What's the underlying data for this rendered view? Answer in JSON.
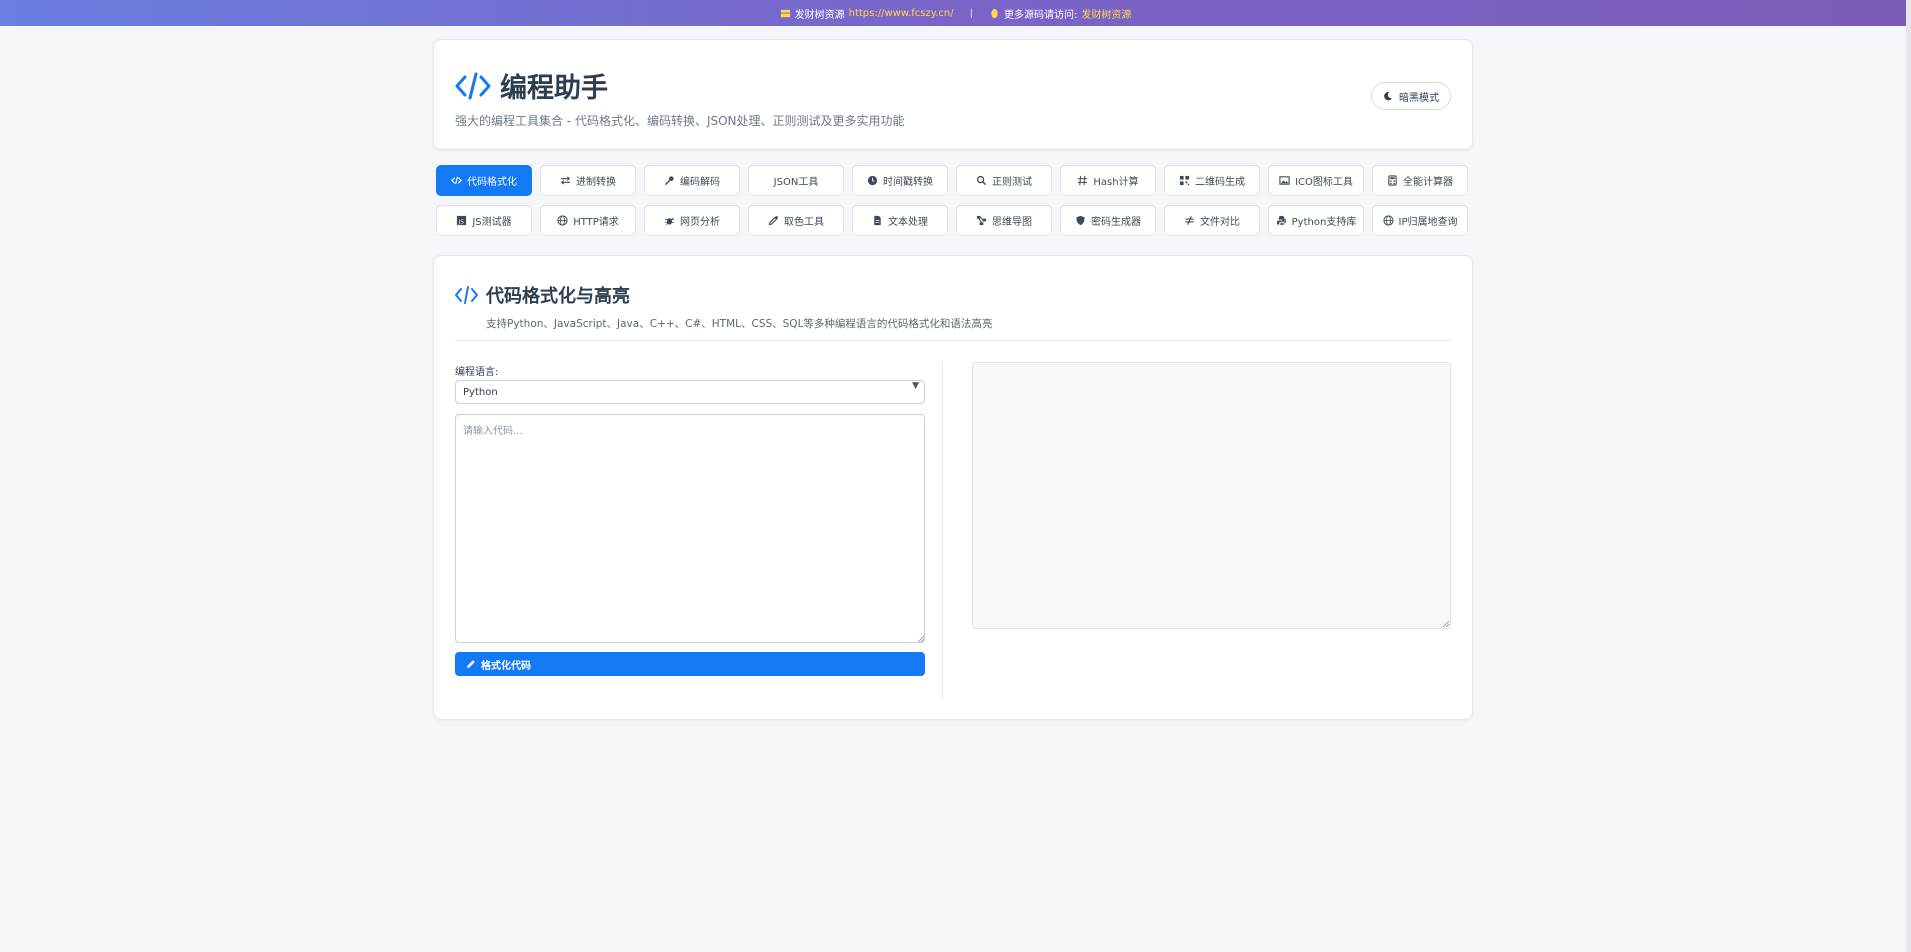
{
  "topbar": {
    "site_label": "发财树资源",
    "site_url": "https://www.fcszy.cn/",
    "separator": "|",
    "more_label": "更多源码请访问:",
    "more_link": "发财树资源"
  },
  "header": {
    "title": "编程助手",
    "subtitle": "强大的编程工具集合 - 代码格式化、编码转换、JSON处理、正则测试及更多实用功能",
    "dark_mode_label": "暗黑模式"
  },
  "tabs": {
    "row1": [
      {
        "label": "代码格式化",
        "icon": "code-icon",
        "active": true
      },
      {
        "label": "进制转换",
        "icon": "exchange-icon",
        "active": false
      },
      {
        "label": "编码解码",
        "icon": "key-icon",
        "active": false
      },
      {
        "label": "JSON工具",
        "icon": "braces-icon",
        "active": false
      },
      {
        "label": "时间戳转换",
        "icon": "clock-icon",
        "active": false
      },
      {
        "label": "正则测试",
        "icon": "search-icon",
        "active": false
      },
      {
        "label": "Hash计算",
        "icon": "hash-icon",
        "active": false
      },
      {
        "label": "二维码生成",
        "icon": "qrcode-icon",
        "active": false
      },
      {
        "label": "ICO图标工具",
        "icon": "image-icon",
        "active": false
      },
      {
        "label": "全能计算器",
        "icon": "calculator-icon",
        "active": false
      }
    ],
    "row2": [
      {
        "label": "JS测试器",
        "icon": "js-icon",
        "active": false
      },
      {
        "label": "HTTP请求",
        "icon": "globe-icon",
        "active": false
      },
      {
        "label": "网页分析",
        "icon": "bug-icon",
        "active": false
      },
      {
        "label": "取色工具",
        "icon": "eyedropper-icon",
        "active": false
      },
      {
        "label": "文本处理",
        "icon": "file-icon",
        "active": false
      },
      {
        "label": "思维导图",
        "icon": "sitemap-icon",
        "active": false
      },
      {
        "label": "密码生成器",
        "icon": "shield-icon",
        "active": false
      },
      {
        "label": "文件对比",
        "icon": "not-equal-icon",
        "active": false
      },
      {
        "label": "Python支持库",
        "icon": "python-icon",
        "active": false
      },
      {
        "label": "IP归属地查询",
        "icon": "globe-icon",
        "active": false
      }
    ]
  },
  "section": {
    "title": "代码格式化与高亮",
    "description": "支持Python、JavaScript、Java、C++、C#、HTML、CSS、SQL等多种编程语言的代码格式化和语法高亮",
    "language_label": "编程语言:",
    "language_value": "Python",
    "code_placeholder": "请输入代码...",
    "format_button": "格式化代码"
  },
  "colors": {
    "accent": "#1479f5",
    "banner_start": "#6a7fe0",
    "banner_end": "#7b5cb8",
    "link_gold": "#ffd84a"
  }
}
